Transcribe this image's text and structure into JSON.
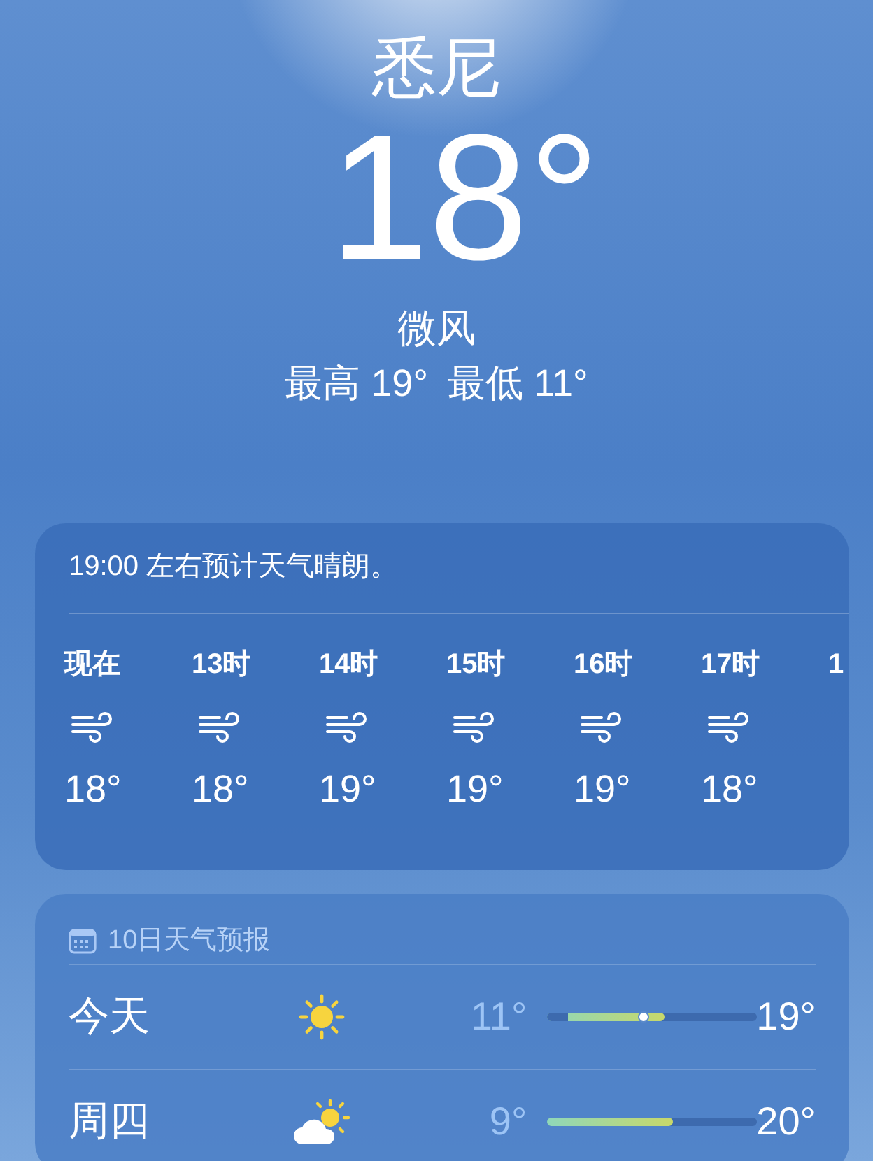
{
  "location": {
    "city": "悉尼",
    "temperature": "18°",
    "condition": "微风",
    "high": "最高 19°",
    "low": "最低 11°"
  },
  "hourly": {
    "summary": "19:00 左右预计天气晴朗。",
    "hours": [
      {
        "label": "现在",
        "kind": "wind",
        "temp": "18°"
      },
      {
        "label": "13时",
        "kind": "wind",
        "temp": "18°"
      },
      {
        "label": "14时",
        "kind": "wind",
        "temp": "19°"
      },
      {
        "label": "15时",
        "kind": "wind",
        "temp": "19°"
      },
      {
        "label": "16时",
        "kind": "wind",
        "temp": "19°"
      },
      {
        "label": "17时",
        "kind": "wind",
        "temp": "18°"
      },
      {
        "label": "1"
      }
    ]
  },
  "daily": {
    "title": "10日天气预报",
    "days": [
      {
        "day": "今天",
        "kind": "sun",
        "low": "11°",
        "high": "19°",
        "range_start": {
          "level": 0.1
        },
        "range_end": {
          "level": 0.56
        },
        "current": {
          "level": 0.46
        }
      },
      {
        "day": "周四",
        "kind": "partly-cloudy",
        "low": "9°",
        "high": "20°",
        "range_end": {
          "level": 0.6
        }
      }
    ]
  }
}
